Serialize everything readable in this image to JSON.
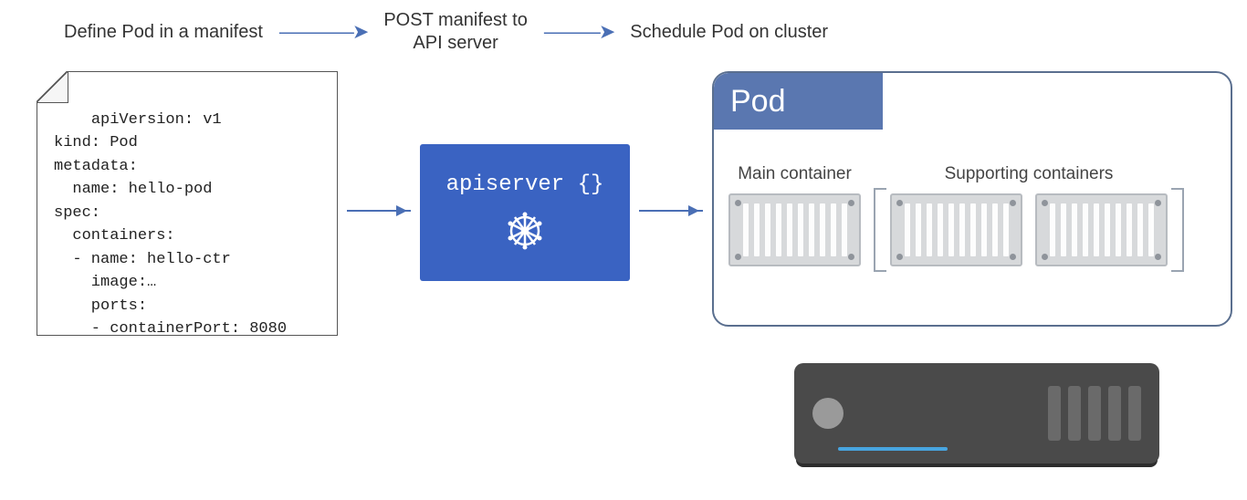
{
  "steps": {
    "s1": "Define Pod in a manifest",
    "s2": "POST manifest to\nAPI server",
    "s3": "Schedule Pod on cluster"
  },
  "manifest": {
    "text": "apiVersion: v1\nkind: Pod\nmetadata:\n  name: hello-pod\nspec:\n  containers:\n  - name: hello-ctr\n    image:…\n    ports:\n    - containerPort: 8080"
  },
  "apiserver": {
    "label": "apiserver {}",
    "icon": "kubernetes-wheel-icon"
  },
  "pod": {
    "title": "Pod",
    "main_label": "Main container",
    "supporting_label": "Supporting containers",
    "main_count": 1,
    "supporting_count": 2
  },
  "server": {
    "name": "cluster-node-server",
    "vent_count": 5
  },
  "colors": {
    "accent_blue": "#3a63c2",
    "pod_tab": "#5a77b0",
    "arrow": "#4a6fb5",
    "server_body": "#4a4a4a"
  }
}
